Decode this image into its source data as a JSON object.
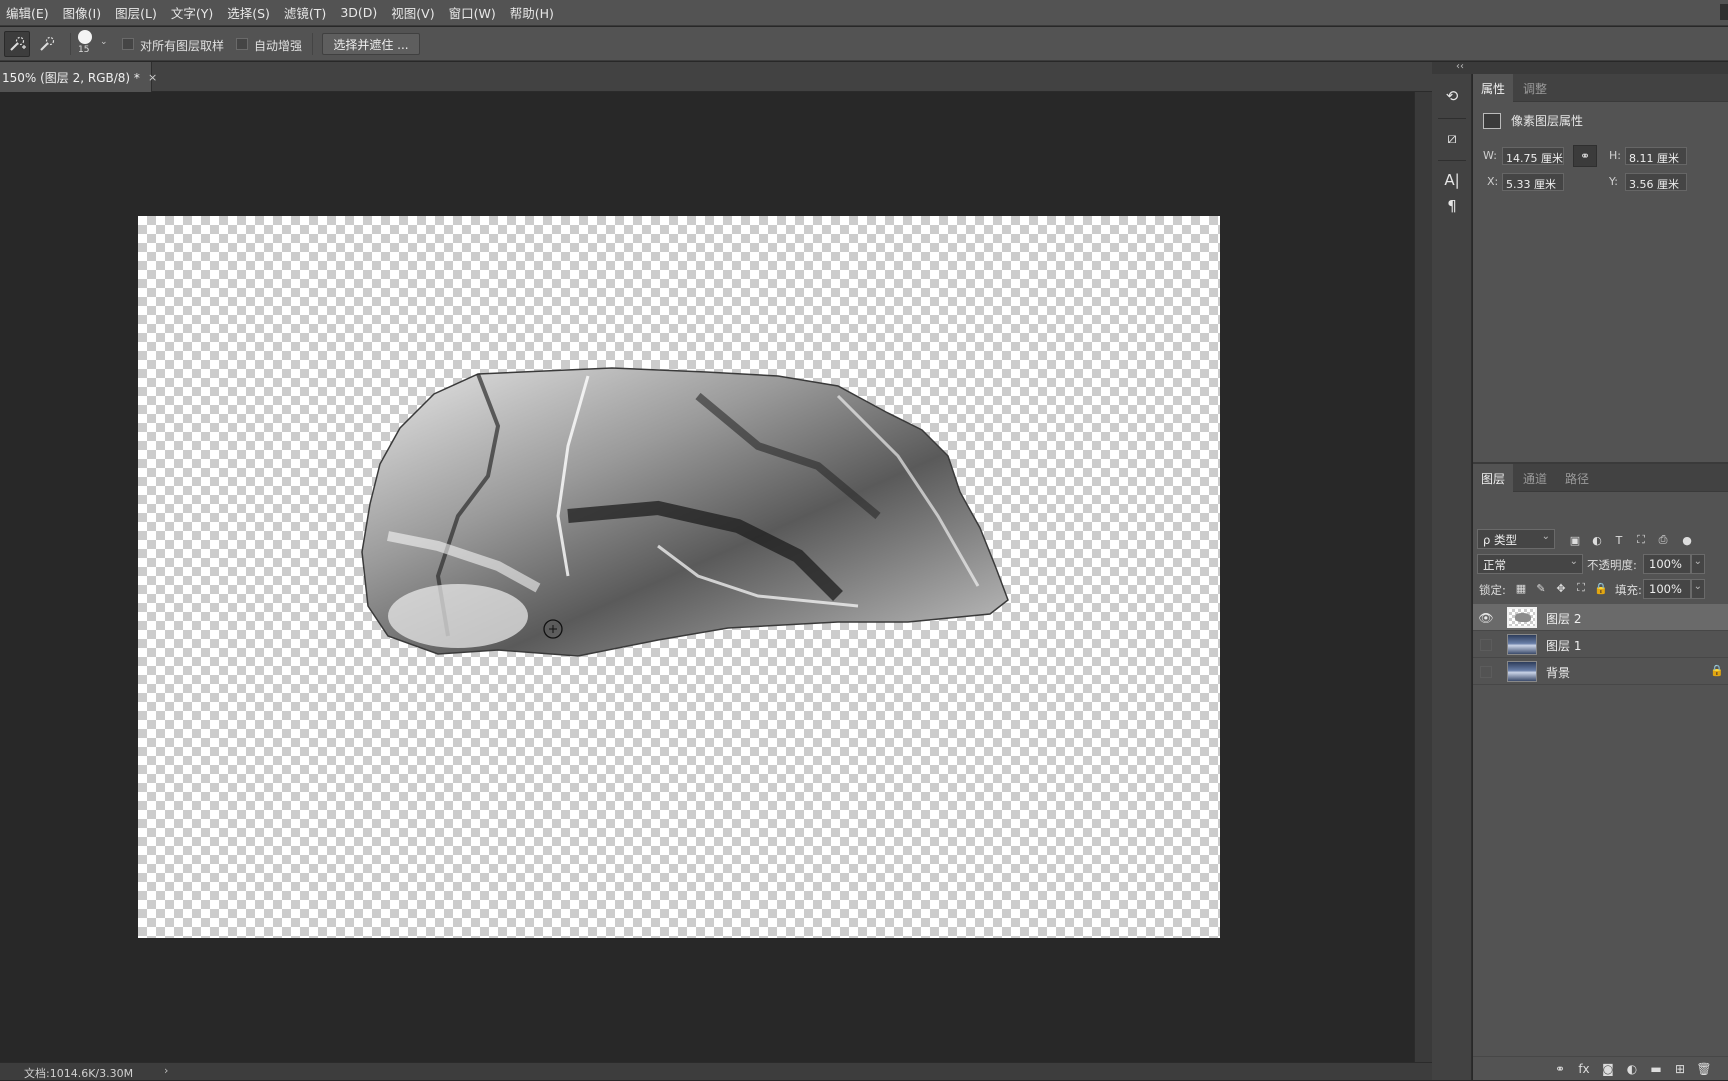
{
  "menu": {
    "items": [
      "编辑(E)",
      "图像(I)",
      "图层(L)",
      "文字(Y)",
      "选择(S)",
      "滤镜(T)",
      "3D(D)",
      "视图(V)",
      "窗口(W)",
      "帮助(H)"
    ]
  },
  "options_bar": {
    "brush_size": "15",
    "sample_all_layers_label": "对所有图层取样",
    "sample_all_layers_checked": false,
    "auto_enhance_label": "自动增强",
    "auto_enhance_checked": false,
    "refine_button_label": "选择并遮住 ..."
  },
  "document_tab": {
    "title": "150% (图层 2, RGB/8) *",
    "close_glyph": "×"
  },
  "status_bar": {
    "text": "文档:1014.6K/3.30M",
    "arrow": "›"
  },
  "dock": {
    "collapse_glyph": "‹‹",
    "icons": [
      "history-icon",
      "brush-settings-icon",
      "character-icon",
      "paragraph-icon"
    ]
  },
  "properties_panel": {
    "tabs": [
      "属性",
      "调整"
    ],
    "active_tab": 0,
    "header": "像素图层属性",
    "w_label": "W:",
    "w_value": "14.75 厘米",
    "h_label": "H:",
    "h_value": "8.11 厘米",
    "x_label": "X:",
    "x_value": "5.33 厘米",
    "y_label": "Y:",
    "y_value": "3.56 厘米"
  },
  "layers_panel": {
    "tabs": [
      "图层",
      "通道",
      "路径"
    ],
    "active_tab": 0,
    "filter_kind": "ρ 类型",
    "blend_mode": "正常",
    "opacity_label": "不透明度:",
    "opacity_value": "100%",
    "lock_label": "锁定:",
    "fill_label": "填充:",
    "fill_value": "100%",
    "layers": [
      {
        "name": "图层 2",
        "visible": true,
        "selected": true,
        "locked": false
      },
      {
        "name": "图层 1",
        "visible": false,
        "selected": false,
        "locked": false
      },
      {
        "name": "背景",
        "visible": false,
        "selected": false,
        "locked": true
      }
    ]
  },
  "colors": {
    "ui_bg": "#535353",
    "workspace": "#282828",
    "selected_layer": "#6a6a6a"
  }
}
